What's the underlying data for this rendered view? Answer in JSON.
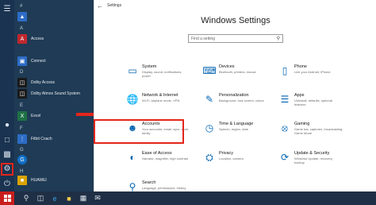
{
  "start_menu": {
    "rail_icons": [
      "hamburger-icon",
      "user-icon",
      "document-icon",
      "pictures-icon",
      "gear-icon",
      "power-icon"
    ],
    "apps": [
      {
        "section": "#",
        "label": "",
        "color": "#2d6cc6",
        "icon": "number-tile-icon"
      },
      {
        "section": "A",
        "label": "Access",
        "color": "#c1272d",
        "icon": "access-tile-icon"
      },
      {
        "section": "",
        "label": "Connect",
        "color": "#2d6cc6",
        "icon": "connect-tile-icon"
      },
      {
        "section": "D",
        "label": "Dolby Access",
        "color": "#1a1a1a",
        "icon": "dolby-tile-icon"
      },
      {
        "section": "",
        "label": "Dolby Atmos Sound System",
        "color": "#1a1a1a",
        "icon": "dolby-tile-icon"
      },
      {
        "section": "E",
        "label": "Excel",
        "color": "#1e7145",
        "icon": "excel-tile-icon"
      },
      {
        "section": "F",
        "label": "Fitbit Coach",
        "color": "#2d6cc6",
        "icon": "fitbit-tile-icon"
      },
      {
        "section": "G",
        "label": "",
        "color": "#0f6fc7",
        "icon": "g-tile-icon"
      },
      {
        "section": "H",
        "label": "HUAWEI",
        "color": "#d9a300",
        "icon": "folder-tile-icon"
      }
    ],
    "letters": [
      "#",
      "A",
      "D",
      "E",
      "F",
      "G",
      "H"
    ]
  },
  "taskbar": {
    "icons": [
      "search-icon",
      "task-view-icon",
      "edge-icon",
      "file-explorer-icon",
      "store-icon",
      "mail-icon"
    ]
  },
  "settings": {
    "window_title": "Settings",
    "heading": "Windows Settings",
    "search_placeholder": "Find a setting",
    "tiles": [
      {
        "title": "System",
        "desc": "Display, sound, notifications, power",
        "icon": "laptop-icon"
      },
      {
        "title": "Devices",
        "desc": "Bluetooth, printers, mouse",
        "icon": "keyboard-icon"
      },
      {
        "title": "Phone",
        "desc": "Link your Android, iPhone",
        "icon": "phone-icon"
      },
      {
        "title": "Network & Internet",
        "desc": "Wi-Fi, airplane mode, VPN",
        "icon": "globe-icon"
      },
      {
        "title": "Personalization",
        "desc": "Background, lock screen, colors",
        "icon": "paintbrush-icon"
      },
      {
        "title": "Apps",
        "desc": "Uninstall, defaults, optional features",
        "icon": "apps-list-icon"
      },
      {
        "title": "Accounts",
        "desc": "Your accounts, email, sync, work, family",
        "icon": "person-icon"
      },
      {
        "title": "Time & Language",
        "desc": "Speech, region, date",
        "icon": "clock-language-icon"
      },
      {
        "title": "Gaming",
        "desc": "Game bar, captures, broadcasting, Game Mode",
        "icon": "xbox-icon"
      },
      {
        "title": "Ease of Access",
        "desc": "Narrator, magnifier, high contrast",
        "icon": "ease-of-access-icon"
      },
      {
        "title": "Privacy",
        "desc": "Location, camera",
        "icon": "lock-icon"
      },
      {
        "title": "Update & Security",
        "desc": "Windows Update, recovery, backup",
        "icon": "sync-icon"
      },
      {
        "title": "Search",
        "desc": "Language, permissions, history",
        "icon": "search-icon"
      }
    ]
  },
  "colors": {
    "accent": "#0063b1",
    "highlight": "#e3261b",
    "start_bg": "#1f3b55",
    "taskbar_bg": "#1f2f45"
  }
}
